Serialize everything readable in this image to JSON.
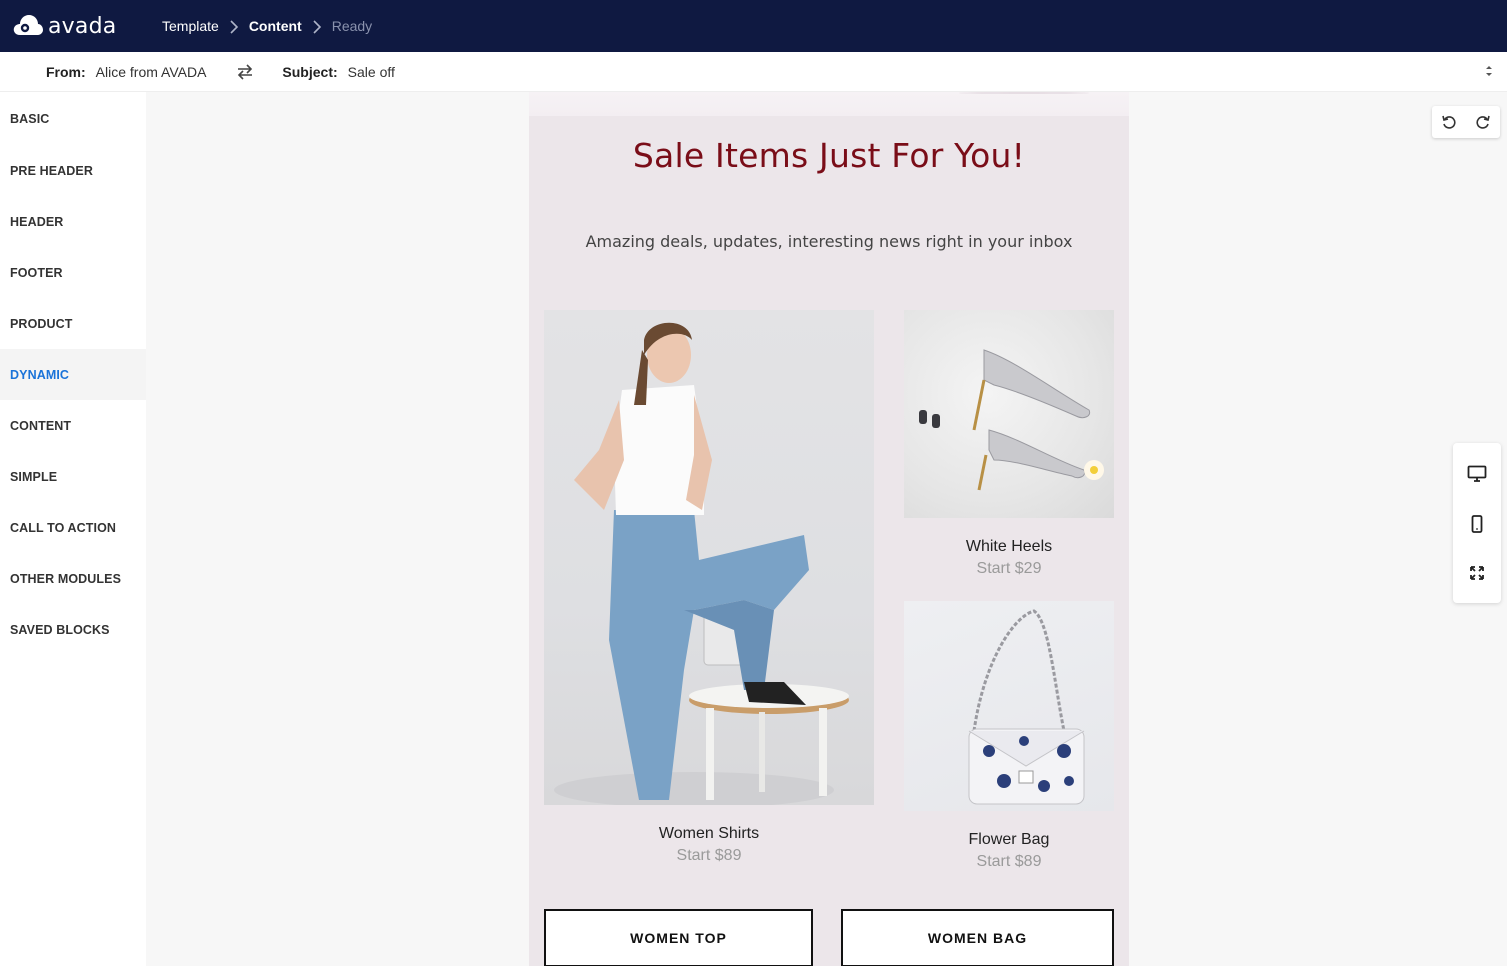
{
  "app": {
    "logo_text": "avada"
  },
  "breadcrumb": [
    {
      "label": "Template"
    },
    {
      "label": "Content"
    },
    {
      "label": "Ready"
    }
  ],
  "email_meta": {
    "from_label": "From:",
    "from_value": "Alice from AVADA",
    "subject_label": "Subject:",
    "subject_value": "Sale off"
  },
  "sidebar": {
    "active": "DYNAMIC",
    "items": [
      {
        "label": "BASIC"
      },
      {
        "label": "PRE HEADER"
      },
      {
        "label": "HEADER"
      },
      {
        "label": "FOOTER"
      },
      {
        "label": "PRODUCT"
      },
      {
        "label": "DYNAMIC"
      },
      {
        "label": "CONTENT"
      },
      {
        "label": "SIMPLE"
      },
      {
        "label": "CALL TO ACTION"
      },
      {
        "label": "OTHER MODULES"
      },
      {
        "label": "SAVED BLOCKS"
      }
    ]
  },
  "email": {
    "title": "Sale Items Just For You!",
    "subtitle": "Amazing deals, updates, interesting news right in your inbox",
    "products": [
      {
        "name": "Women Shirts",
        "price": "Start $89"
      },
      {
        "name": "White Heels",
        "price": "Start $29"
      },
      {
        "name": "Flower Bag",
        "price": "Start $89"
      }
    ],
    "buttons": [
      {
        "label": "WOMEN TOP"
      },
      {
        "label": "WOMEN BAG"
      }
    ],
    "colors": {
      "title": "#7a0d18",
      "background": "#ece6ea"
    }
  },
  "toolbar": {
    "history_icons": [
      "undo-icon",
      "redo-icon"
    ],
    "device_icons": [
      "desktop-icon",
      "mobile-icon",
      "fullscreen-icon"
    ]
  },
  "theme": {
    "topbar": "#0f1941",
    "accent": "#1a73d9"
  }
}
